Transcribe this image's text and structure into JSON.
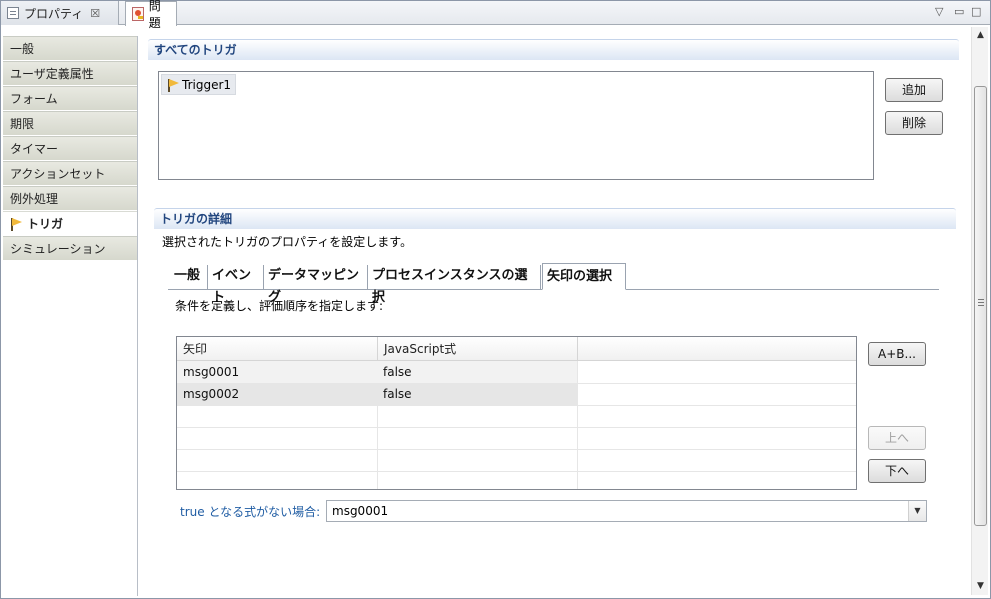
{
  "window": {
    "tabs": [
      {
        "label": "プロパティ",
        "close_glyph": "☒",
        "icon": "properties-icon"
      },
      {
        "label": "問題",
        "icon": "problems-icon"
      }
    ],
    "controls": {
      "menu": "▽",
      "minimize": "▭",
      "maximize": "□"
    }
  },
  "sidebar": {
    "items": [
      {
        "label": "一般"
      },
      {
        "label": "ユーザ定義属性"
      },
      {
        "label": "フォーム"
      },
      {
        "label": "期限"
      },
      {
        "label": "タイマー"
      },
      {
        "label": "アクションセット"
      },
      {
        "label": "例外処理"
      },
      {
        "label": "トリガ",
        "active": true,
        "icon": "trigger-flag-icon"
      },
      {
        "label": "シミュレーション"
      }
    ]
  },
  "all_triggers": {
    "title": "すべてのトリガ",
    "items": [
      {
        "label": "Trigger1",
        "icon": "trigger-flag-icon"
      }
    ],
    "add_label": "追加",
    "delete_label": "削除"
  },
  "trigger_details": {
    "title": "トリガの詳細",
    "description": "選択されたトリガのプロパティを設定します。",
    "tabs": [
      {
        "label": "一般"
      },
      {
        "label": "イベント"
      },
      {
        "label": "データマッピング"
      },
      {
        "label": "プロセスインスタンスの選択"
      },
      {
        "label": "矢印の選択",
        "active": true
      }
    ],
    "instruction": "条件を定義し、評価順序を指定します:",
    "table": {
      "columns": [
        "矢印",
        "JavaScript式",
        ""
      ],
      "rows": [
        {
          "arrow": "msg0001",
          "expr": "false"
        },
        {
          "arrow": "msg0002",
          "expr": "false"
        }
      ]
    },
    "expr_button_label": "A+B...",
    "up_label": "上へ",
    "down_label": "下へ",
    "fallback": {
      "label": "true となる式がない場合:",
      "value": "msg0001"
    }
  },
  "colors": {
    "section_title": "#22467f",
    "link_label": "#1f5ca3",
    "nav_bg": "#d6d8cd"
  }
}
